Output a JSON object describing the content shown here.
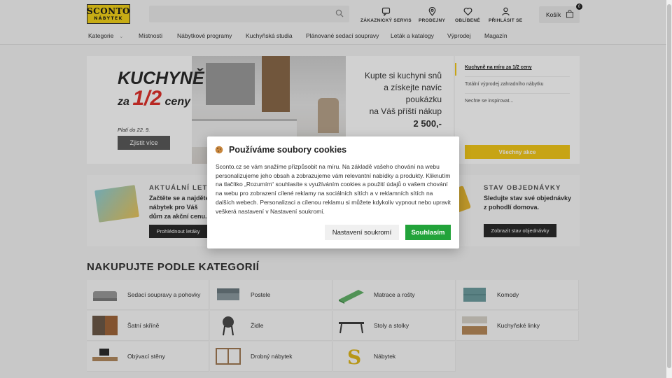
{
  "header": {
    "logo_line1": "SCONTO",
    "logo_line2": "NÁBYTEK",
    "links": [
      "ZÁKAZNICKÝ SERVIS",
      "PRODEJNY",
      "OBLÍBENÉ",
      "PŘIHLÁSIT SE"
    ],
    "cart_label": "Košík",
    "cart_count": "0"
  },
  "nav": {
    "items": [
      "Kategorie",
      "Místnosti",
      "Nábytkové programy",
      "Kuchyňská studia",
      "Plánované sedací soupravy",
      "Leták a katalogy",
      "Výprodej",
      "Magazín"
    ]
  },
  "hero": {
    "title_line1": "KUCHYNĚ",
    "title_za": "za",
    "title_half": "1/2",
    "title_ceny": "ceny",
    "side_text_1": "Kupte si kuchyni snů",
    "side_text_2": "a získejte navíc poukázku",
    "side_text_3": "na Váš příští nákup",
    "side_price": "2 500,-",
    "valid_until": "Platí do 22. 9.",
    "button": "Zjistit více"
  },
  "promo": {
    "items": [
      "Kuchyně na míru za 1/2 ceny",
      "Totální výprodej zahradního nábytku",
      "Nechte se inspirovat..."
    ],
    "button": "Všechny akce"
  },
  "info": {
    "leaflet_title": "AKTUÁLNÍ LETÁK",
    "leaflet_text": "Začtěte se a najděte nábytek pro Váš dům za akční cenu.",
    "leaflet_button": "Prohlédnout letáky",
    "order_title": "STAV OBJEDNÁVKY",
    "order_text": "Sledujte stav své objednávky z pohodlí domova.",
    "order_button": "Zobrazit stav objednávky"
  },
  "categories": {
    "heading": "NAKUPUJTE PODLE KATEGORIÍ",
    "items": [
      "Sedací soupravy a pohovky",
      "Postele",
      "Matrace a rošty",
      "Komody",
      "Šatní skříně",
      "Židle",
      "Stoly a stolky",
      "Kuchyňské linky",
      "Obývací stěny",
      "Drobný nábytek",
      "Nábytek"
    ]
  },
  "cookie": {
    "title": "Používáme soubory cookies",
    "text": "Sconto.cz se vám snažíme přizpůsobit na míru. Na základě vašeho chování na webu personalizujeme jeho obsah a zobrazujeme vám relevantní nabídky a produkty. Kliknutím na tlačítko „Rozumím“ souhlasíte s využíváním cookies a použití údajů o vašem chování na webu pro zobrazení cílené reklamy na sociálních sítích a v reklamních sítích na dalších webech. Personalizaci a cílenou reklamu si můžete kdykoliv vypnout nebo upravit veškerá nastavení v Nastavení soukromí.",
    "settings_button": "Nastavení soukromí",
    "accept_button": "Souhlasím"
  },
  "colors": {
    "brand_yellow": "#f3d21a",
    "accept_green": "#22a33a",
    "accent_red": "#e1312b"
  }
}
